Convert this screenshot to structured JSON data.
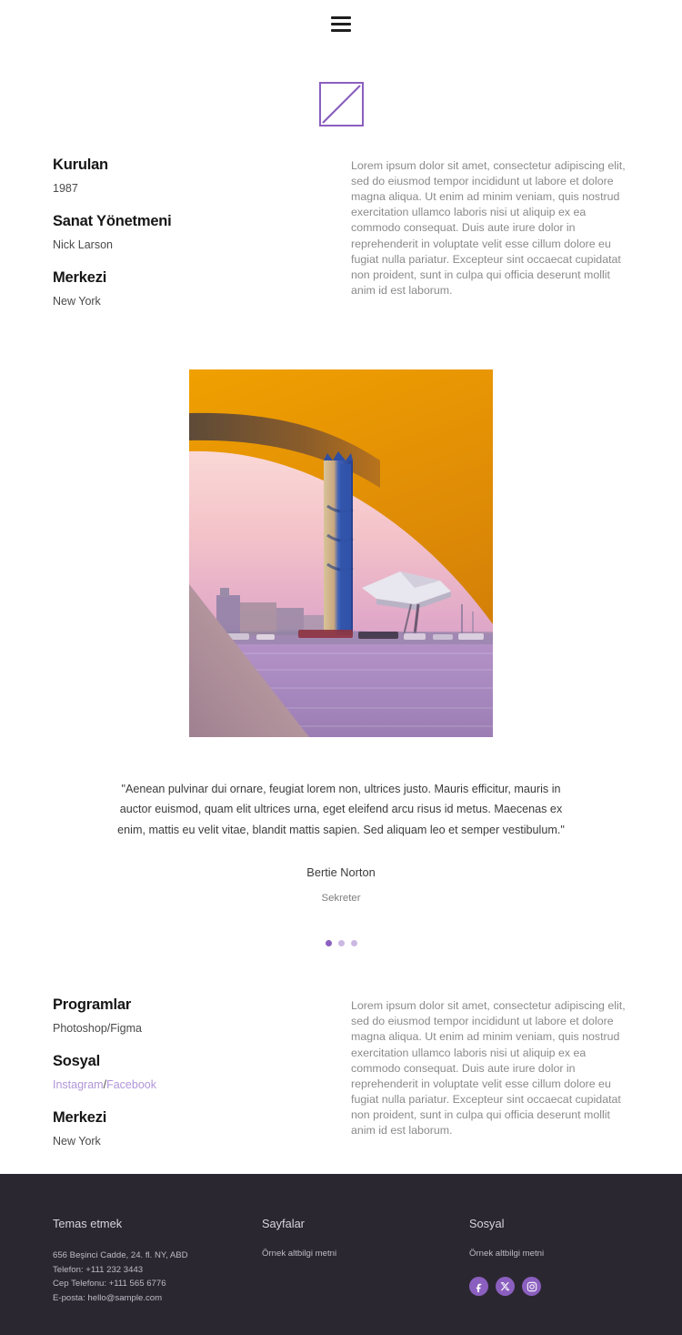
{
  "header": {
    "menu_icon": "hamburger-menu-icon"
  },
  "logo": {
    "name": "brand-logo",
    "color": "#8b5fbf"
  },
  "intro": {
    "fields": [
      {
        "title": "Kurulan",
        "value": "1987"
      },
      {
        "title": "Sanat Yönetmeni",
        "value": "Nick Larson"
      },
      {
        "title": "Merkezi",
        "value": "New York"
      }
    ],
    "paragraph": "Lorem ipsum dolor sit amet, consectetur adipiscing elit, sed do eiusmod tempor incididunt ut labore et dolore magna aliqua. Ut enim ad minim veniam, quis nostrud exercitation ullamco laboris nisi ut aliquip ex ea commodo consequat. Duis aute irure dolor in reprehenderit in voluptate velit esse cillum dolore eu fugiat nulla pariatur. Excepteur sint occaecat cupidatat non proident, sunt in culpa qui officia deserunt mollit anim id est laborum."
  },
  "photo": {
    "alt": "sunset-waterfront-cityscape-with-blue-skyscraper"
  },
  "testimonial": {
    "quote": "\"Aenean pulvinar dui ornare, feugiat lorem non, ultrices justo. Mauris efficitur, mauris in auctor euismod, quam elit ultrices urna, eget eleifend arcu risus id metus. Maecenas ex enim, mattis eu velit vitae, blandit mattis sapien. Sed aliquam leo et semper vestibulum.\"",
    "author": "Bertie Norton",
    "role": "Sekreter",
    "dots": 3,
    "active_dot": 0,
    "active_color": "#8b5fbf",
    "inactive_color": "#cbb8e2"
  },
  "details": {
    "program_title": "Programlar",
    "program_value": "Photoshop/Figma",
    "social_title": "Sosyal",
    "social_link_1": "Instagram",
    "social_separator": "/",
    "social_link_2": "Facebook",
    "hq_title": "Merkezi",
    "hq_value": "New York",
    "paragraph": "Lorem ipsum dolor sit amet, consectetur adipiscing elit, sed do eiusmod tempor incididunt ut labore et dolore magna aliqua. Ut enim ad minim veniam, quis nostrud exercitation ullamco laboris nisi ut aliquip ex ea commodo consequat. Duis aute irure dolor in reprehenderit in voluptate velit esse cillum dolore eu fugiat nulla pariatur. Excepteur sint occaecat cupidatat non proident, sunt in culpa qui officia deserunt mollit anim id est laborum."
  },
  "footer": {
    "background": "#2b2731",
    "contact": {
      "heading": "Temas etmek",
      "address": "656 Beşinci Cadde, 24. fl. NY, ABD",
      "phone": "Telefon: +111 232 3443",
      "mobile": "Cep Telefonu: +111 565 6776",
      "email": "E-posta: hello@sample.com"
    },
    "pages": {
      "heading": "Sayfalar",
      "text": "Örnek altbilgi metni"
    },
    "social": {
      "heading": "Sosyal",
      "text": "Örnek altbilgi metni",
      "icons": [
        "facebook-icon",
        "x-twitter-icon",
        "instagram-icon"
      ],
      "icon_color": "#8b5fbf"
    }
  }
}
